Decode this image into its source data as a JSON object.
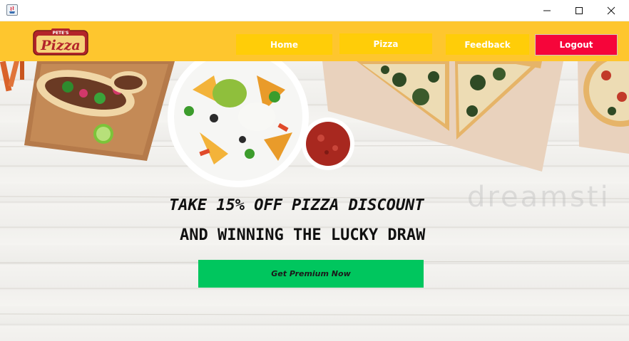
{
  "window": {
    "icon": "java-app-icon",
    "controls": {
      "minimize": "minimize-icon",
      "maximize": "maximize-icon",
      "close": "close-icon"
    }
  },
  "header": {
    "logo": {
      "small_text": "PETE'S",
      "main_text": "Pizza"
    },
    "nav": {
      "home_label": "Home",
      "pizza_label": "Pizza",
      "feedback_label": "Feedback",
      "logout_label": "Logout"
    }
  },
  "hero": {
    "watermark": "dreamsti",
    "headline_line1": "TAKE 15% OFF PIZZA DISCOUNT",
    "headline_line2": "AND WINNING THE LUCKY DRAW",
    "cta_label": "Get Premium Now"
  },
  "colors": {
    "nav_background": "#fec62e",
    "nav_button": "#ffcd08",
    "logout_button": "#f6053a",
    "cta_button": "#00c65e"
  }
}
